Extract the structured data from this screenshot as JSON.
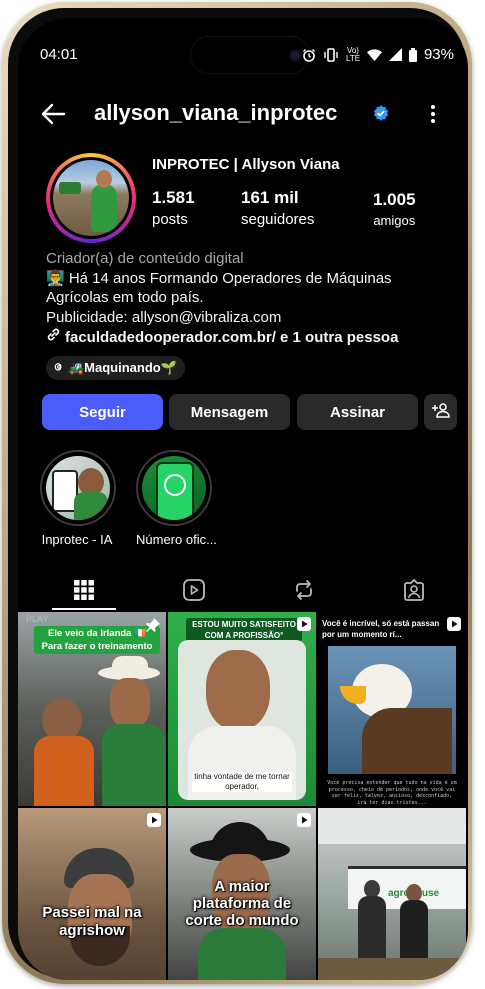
{
  "status_bar": {
    "time": "04:01",
    "network": "Vo) LTE",
    "battery": "93%"
  },
  "header": {
    "username": "allyson_viana_inprotec",
    "verified_color": "#3897f0"
  },
  "profile": {
    "display_name": "INPROTEC | Allyson Viana",
    "posts_count": "1.581",
    "posts_label": "posts",
    "followers_count": "161 mil",
    "followers_label": "seguidores",
    "friends_count": "1.005",
    "friends_label": "amigos"
  },
  "bio": {
    "category": "Criador(a) de conteúdo digital",
    "line1": "👨‍🏫 Há 14 anos Formando Operadores de Máquinas",
    "line2": "Agrícolas em todo país.",
    "line3": "Publicidade: allyson@vibraliza.com",
    "link_text": "faculdadedooperador.com.br/ e 1 outra pessoa"
  },
  "threads_chip": {
    "label": "🚜Maquinando🌱"
  },
  "actions": {
    "follow": "Seguir",
    "message": "Mensagem",
    "subscribe": "Assinar",
    "accent_color": "#4a5df9"
  },
  "highlights": [
    {
      "label": "Inprotec - IA"
    },
    {
      "label": "Número ofic..."
    }
  ],
  "tabs": [
    {
      "icon": "grid-icon"
    },
    {
      "icon": "reels-icon"
    },
    {
      "icon": "reposts-icon"
    },
    {
      "icon": "tagged-icon"
    }
  ],
  "posts": [
    {
      "caption_top": "Ele veio da Irlanda 🇮🇪 Para fazer o treinamento",
      "badge": "PLAY"
    },
    {
      "caption_top": "ESTOU MUITO SATISFEITO COM A PROFISSÃO°",
      "caption_bottom": "tinha vontade de me tornar operador,"
    },
    {
      "caption_top": "Você é incrível, só está passan por um momento rí...",
      "caption_bottom": "Você precisa entender que tudo na vida é um processo, cheio de períodos, onde você vai ser feliz, talvez, ansioso, desconfiado, irá ter dias tristes..."
    },
    {
      "caption": "Passei mal na agrishow"
    },
    {
      "caption": "A maior plataforma de corte do mundo"
    },
    {
      "caption": "agrohouse"
    }
  ]
}
